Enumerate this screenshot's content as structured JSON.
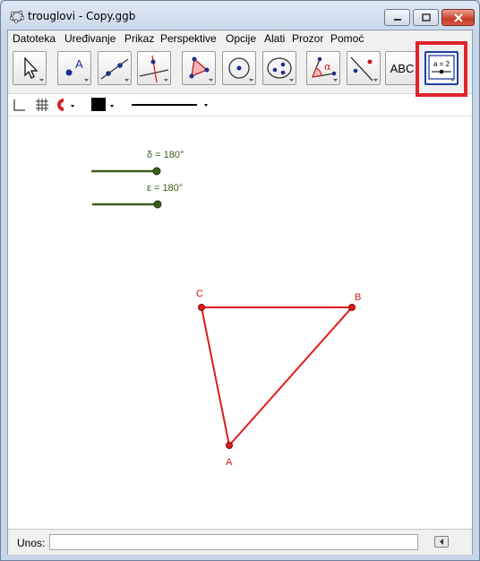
{
  "window": {
    "title": "trouglovi - Copy.ggb"
  },
  "menu": [
    "Datoteka",
    "Uređivanje",
    "Prikaz",
    "Perspektive",
    "Opcije",
    "Alati",
    "Prozor",
    "Pomoć"
  ],
  "toolbar": {
    "tools": [
      {
        "name": "move-tool",
        "icon": "arrow-cursor-icon"
      },
      {
        "name": "point-tool",
        "icon": "point-icon",
        "text": "A"
      },
      {
        "name": "line-tool",
        "icon": "line-through-points-icon"
      },
      {
        "name": "perpendicular-tool",
        "icon": "perpendicular-line-icon"
      },
      {
        "name": "polygon-tool",
        "icon": "polygon-icon"
      },
      {
        "name": "circle-tool",
        "icon": "circle-center-point-icon"
      },
      {
        "name": "ellipse-tool",
        "icon": "ellipse-icon"
      },
      {
        "name": "angle-tool",
        "icon": "angle-icon",
        "text": "α"
      },
      {
        "name": "reflect-tool",
        "icon": "reflect-icon"
      },
      {
        "name": "text-tool",
        "icon": "text-icon",
        "text": "ABC"
      },
      {
        "name": "slider-tool",
        "icon": "slider-icon",
        "text": "a = 2"
      }
    ]
  },
  "sliders": [
    {
      "label": "δ = 180°",
      "value_deg": 180,
      "color": "#3a5e1a"
    },
    {
      "label": "ε = 180°",
      "value_deg": 180,
      "color": "#3a5e1a"
    }
  ],
  "points": [
    {
      "label": "A",
      "color": "#c41a1a"
    },
    {
      "label": "B",
      "color": "#c41a1a"
    },
    {
      "label": "C",
      "color": "#c41a1a"
    }
  ],
  "triangle": {
    "color": "#e11b1b"
  },
  "input": {
    "label": "Unos:",
    "value": ""
  },
  "highlight_color": "#e2222a"
}
